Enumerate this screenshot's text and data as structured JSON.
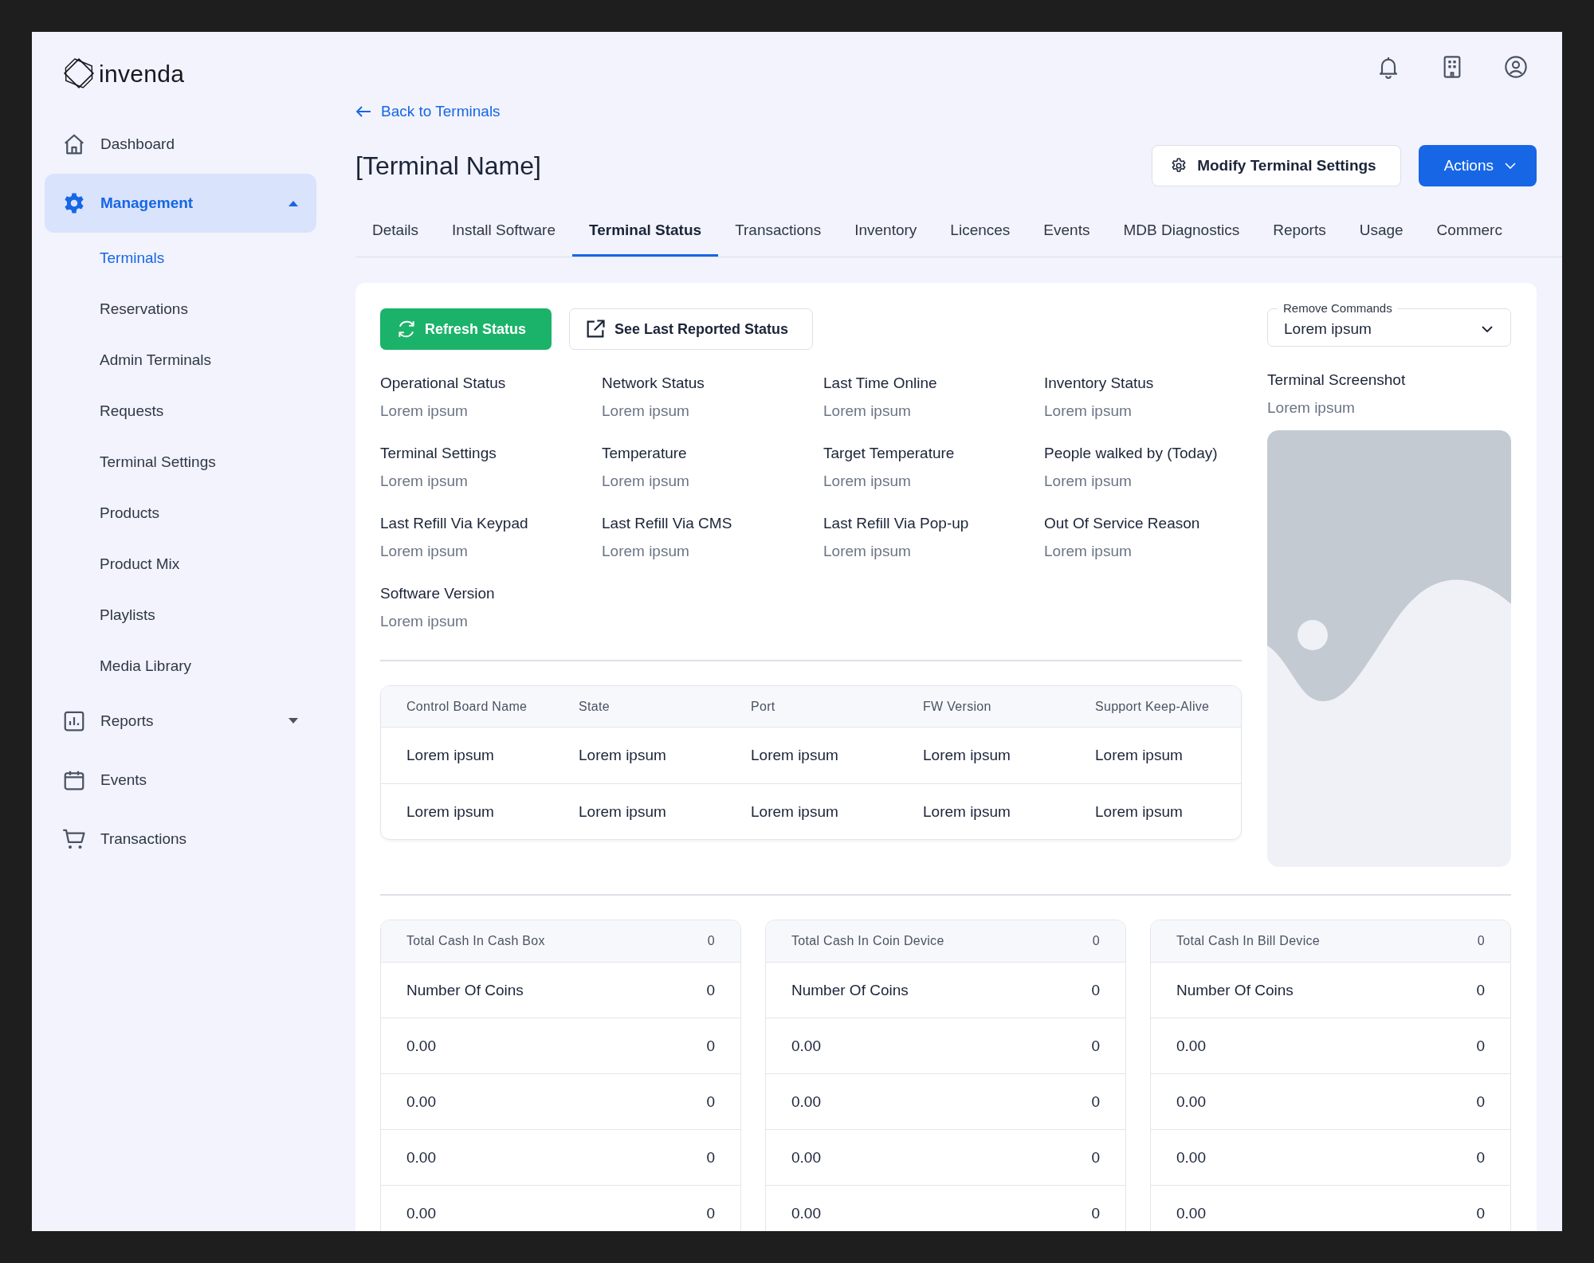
{
  "logo": {
    "text": "invenda"
  },
  "sidebar": {
    "items": [
      {
        "label": "Dashboard",
        "selected": false
      },
      {
        "label": "Management",
        "selected": true,
        "expanded": true,
        "children": [
          {
            "label": "Terminals",
            "selected": true
          },
          {
            "label": "Reservations",
            "selected": false
          },
          {
            "label": "Admin Terminals",
            "selected": false
          },
          {
            "label": "Requests",
            "selected": false
          },
          {
            "label": "Terminal Settings",
            "selected": false
          },
          {
            "label": "Products",
            "selected": false
          },
          {
            "label": "Product Mix",
            "selected": false
          },
          {
            "label": "Playlists",
            "selected": false
          },
          {
            "label": "Media Library",
            "selected": false
          }
        ]
      },
      {
        "label": "Reports",
        "selected": false,
        "expanded": false
      },
      {
        "label": "Events",
        "selected": false
      },
      {
        "label": "Transactions",
        "selected": false
      }
    ]
  },
  "back_link": "Back to Terminals",
  "title": "[Terminal Name]",
  "header_buttons": {
    "modify": "Modify Terminal Settings",
    "actions": "Actions"
  },
  "tabs": [
    {
      "label": "Details",
      "selected": false
    },
    {
      "label": "Install Software",
      "selected": false
    },
    {
      "label": "Terminal Status",
      "selected": true
    },
    {
      "label": "Transactions",
      "selected": false
    },
    {
      "label": "Inventory",
      "selected": false
    },
    {
      "label": "Licences",
      "selected": false
    },
    {
      "label": "Events",
      "selected": false
    },
    {
      "label": "MDB Diagnostics",
      "selected": false
    },
    {
      "label": "Reports",
      "selected": false
    },
    {
      "label": "Usage",
      "selected": false
    },
    {
      "label": "Commerc",
      "selected": false
    }
  ],
  "status": {
    "refresh_button": "Refresh Status",
    "last_reported_button": "See Last Reported Status",
    "remove_commands": {
      "label": "Remove Commands",
      "value": "Lorem ipsum"
    },
    "fields": [
      {
        "label": "Operational Status",
        "value": "Lorem ipsum"
      },
      {
        "label": "Network Status",
        "value": "Lorem ipsum"
      },
      {
        "label": "Last Time Online",
        "value": "Lorem ipsum"
      },
      {
        "label": "Inventory Status",
        "value": "Lorem ipsum"
      },
      {
        "label": "Terminal Settings",
        "value": "Lorem ipsum"
      },
      {
        "label": "Temperature",
        "value": "Lorem ipsum"
      },
      {
        "label": "Target Temperature",
        "value": "Lorem ipsum"
      },
      {
        "label": "People walked by (Today)",
        "value": "Lorem ipsum"
      },
      {
        "label": "Last Refill Via Keypad",
        "value": "Lorem ipsum"
      },
      {
        "label": "Last Refill Via CMS",
        "value": "Lorem ipsum"
      },
      {
        "label": "Last Refill Via Pop-up",
        "value": "Lorem ipsum"
      },
      {
        "label": "Out Of Service Reason",
        "value": "Lorem ipsum"
      },
      {
        "label": "Software Version",
        "value": "Lorem ipsum"
      }
    ],
    "screenshot": {
      "label": "Terminal Screenshot",
      "value": "Lorem ipsum",
      "kind": "picture"
    }
  },
  "table": {
    "columns": [
      "Control Board Name",
      "State",
      "Port",
      "FW Version",
      "Support Keep-Alive"
    ],
    "rows": [
      [
        "Lorem ipsum",
        "Lorem ipsum",
        "Lorem ipsum",
        "Lorem ipsum",
        "Lorem ipsum"
      ],
      [
        "Lorem ipsum",
        "Lorem ipsum",
        "Lorem ipsum",
        "Lorem ipsum",
        "Lorem ipsum"
      ]
    ]
  },
  "cash_cards": [
    {
      "title": "Total Cash In Cash Box",
      "total": "0",
      "rows": [
        {
          "label": "Number Of Coins",
          "value": "0"
        },
        {
          "label": "0.00",
          "value": "0"
        },
        {
          "label": "0.00",
          "value": "0"
        },
        {
          "label": "0.00",
          "value": "0"
        },
        {
          "label": "0.00",
          "value": "0"
        }
      ]
    },
    {
      "title": "Total Cash In Coin Device",
      "total": "0",
      "rows": [
        {
          "label": "Number Of Coins",
          "value": "0"
        },
        {
          "label": "0.00",
          "value": "0"
        },
        {
          "label": "0.00",
          "value": "0"
        },
        {
          "label": "0.00",
          "value": "0"
        },
        {
          "label": "0.00",
          "value": "0"
        }
      ]
    },
    {
      "title": "Total Cash In Bill Device",
      "total": "0",
      "rows": [
        {
          "label": "Number Of Coins",
          "value": "0"
        },
        {
          "label": "0.00",
          "value": "0"
        },
        {
          "label": "0.00",
          "value": "0"
        },
        {
          "label": "0.00",
          "value": "0"
        },
        {
          "label": "0.00",
          "value": "0"
        }
      ]
    }
  ]
}
